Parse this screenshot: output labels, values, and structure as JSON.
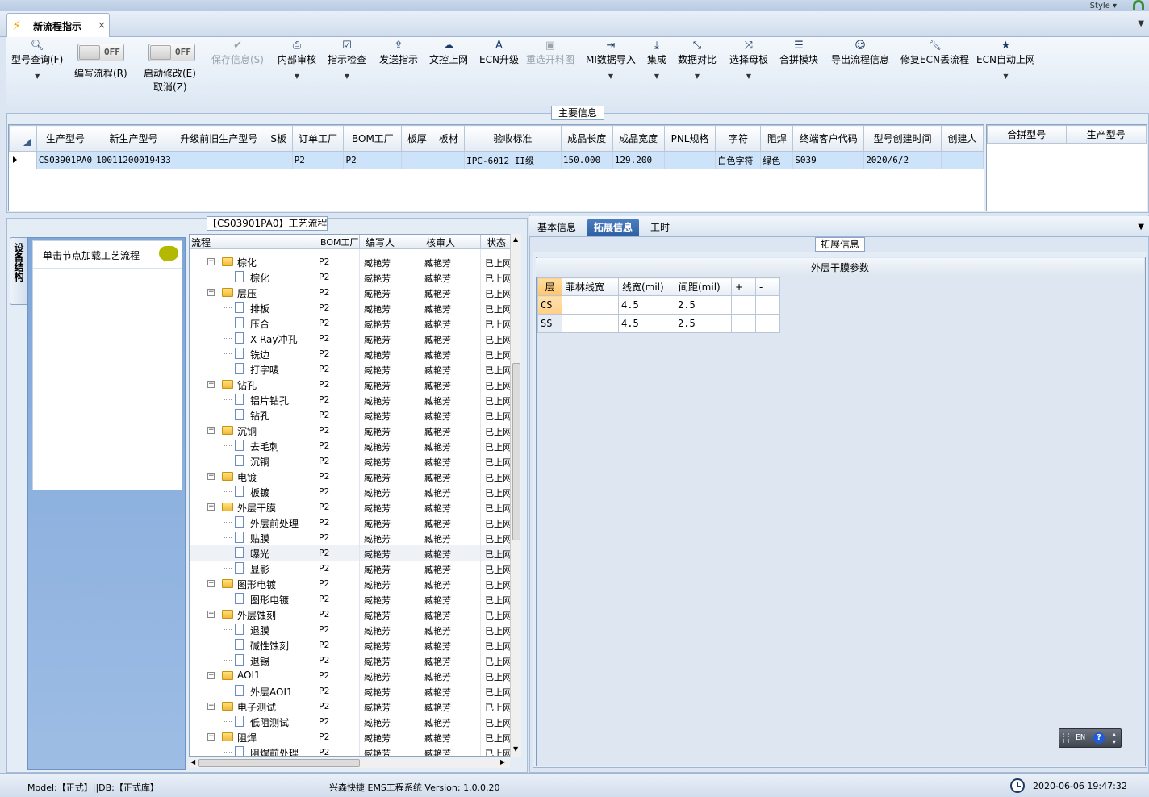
{
  "topbar": {
    "style_label": "Style ▾"
  },
  "doc_tab": {
    "title": "新流程指示",
    "close": "×"
  },
  "ribbon": {
    "query": "型号查询(F)",
    "toggle_off": "OFF",
    "write_flow": "编写流程(R)",
    "start_modify": "启动修改(E)",
    "cancel": "取消(Z)",
    "save_info": "保存信息(S)",
    "internal_review": "内部审核",
    "instruction_check": "指示检查",
    "send_instruction": "发送指示",
    "file_control_upload": "文控上网",
    "ecn_upgrade": "ECN升级",
    "reselect_drawing": "重选开料图",
    "mi_import": "MI数据导入",
    "integrate": "集成",
    "data_compare": "数据对比",
    "select_mother": "选择母板",
    "combine_module": "合拼模块",
    "export_flow": "导出流程信息",
    "fix_ecn": "修复ECN丢流程",
    "ecn_auto_upload": "ECN自动上网"
  },
  "main_info": {
    "title": "主要信息",
    "columns": [
      "生产型号",
      "新生产型号",
      "升级前旧生产型号",
      "S板",
      "订单工厂",
      "BOM工厂",
      "板厚",
      "板材",
      "验收标准",
      "成品长度",
      "成品宽度",
      "PNL规格",
      "字符",
      "阻焊",
      "终端客户代码",
      "型号创建时间",
      "创建人"
    ],
    "row": [
      "CS03901PA0",
      "10011200019433",
      "",
      "",
      "P2",
      "P2",
      "",
      "",
      "IPC-6012 II级",
      "150.000",
      "129.200",
      "",
      "白色字符",
      "绿色",
      "S039",
      "2020/6/2",
      ""
    ],
    "right_columns": [
      "合拼型号",
      "生产型号"
    ]
  },
  "process": {
    "title": "【CS03901PA0】工艺流程",
    "side_tab": "设备结构",
    "load_hint": "单击节点加载工艺流程",
    "headers": [
      "流程",
      "BOM工厂",
      "编写人",
      "核审人",
      "状态"
    ],
    "rows": [
      {
        "name": "棕化",
        "level": 0,
        "factory": "P2",
        "writer": "臧艳芳",
        "reviewer": "臧艳芳",
        "status": "已上网"
      },
      {
        "name": "棕化",
        "level": 1,
        "factory": "P2",
        "writer": "臧艳芳",
        "reviewer": "臧艳芳",
        "status": "已上网"
      },
      {
        "name": "层压",
        "level": 0,
        "factory": "P2",
        "writer": "臧艳芳",
        "reviewer": "臧艳芳",
        "status": "已上网"
      },
      {
        "name": "排板",
        "level": 1,
        "factory": "P2",
        "writer": "臧艳芳",
        "reviewer": "臧艳芳",
        "status": "已上网"
      },
      {
        "name": "压合",
        "level": 1,
        "factory": "P2",
        "writer": "臧艳芳",
        "reviewer": "臧艳芳",
        "status": "已上网"
      },
      {
        "name": "X-Ray冲孔",
        "level": 1,
        "factory": "P2",
        "writer": "臧艳芳",
        "reviewer": "臧艳芳",
        "status": "已上网"
      },
      {
        "name": "铣边",
        "level": 1,
        "factory": "P2",
        "writer": "臧艳芳",
        "reviewer": "臧艳芳",
        "status": "已上网"
      },
      {
        "name": "打字唛",
        "level": 1,
        "factory": "P2",
        "writer": "臧艳芳",
        "reviewer": "臧艳芳",
        "status": "已上网"
      },
      {
        "name": "钻孔",
        "level": 0,
        "factory": "P2",
        "writer": "臧艳芳",
        "reviewer": "臧艳芳",
        "status": "已上网"
      },
      {
        "name": "铝片钻孔",
        "level": 1,
        "factory": "P2",
        "writer": "臧艳芳",
        "reviewer": "臧艳芳",
        "status": "已上网"
      },
      {
        "name": "钻孔",
        "level": 1,
        "factory": "P2",
        "writer": "臧艳芳",
        "reviewer": "臧艳芳",
        "status": "已上网"
      },
      {
        "name": "沉铜",
        "level": 0,
        "factory": "P2",
        "writer": "臧艳芳",
        "reviewer": "臧艳芳",
        "status": "已上网"
      },
      {
        "name": "去毛刺",
        "level": 1,
        "factory": "P2",
        "writer": "臧艳芳",
        "reviewer": "臧艳芳",
        "status": "已上网"
      },
      {
        "name": "沉铜",
        "level": 1,
        "factory": "P2",
        "writer": "臧艳芳",
        "reviewer": "臧艳芳",
        "status": "已上网"
      },
      {
        "name": "电镀",
        "level": 0,
        "factory": "P2",
        "writer": "臧艳芳",
        "reviewer": "臧艳芳",
        "status": "已上网"
      },
      {
        "name": "板镀",
        "level": 1,
        "factory": "P2",
        "writer": "臧艳芳",
        "reviewer": "臧艳芳",
        "status": "已上网"
      },
      {
        "name": "外层干膜",
        "level": 0,
        "factory": "P2",
        "writer": "臧艳芳",
        "reviewer": "臧艳芳",
        "status": "已上网"
      },
      {
        "name": "外层前处理",
        "level": 1,
        "factory": "P2",
        "writer": "臧艳芳",
        "reviewer": "臧艳芳",
        "status": "已上网"
      },
      {
        "name": "贴膜",
        "level": 1,
        "factory": "P2",
        "writer": "臧艳芳",
        "reviewer": "臧艳芳",
        "status": "已上网"
      },
      {
        "name": "曝光",
        "level": 1,
        "factory": "P2",
        "writer": "臧艳芳",
        "reviewer": "臧艳芳",
        "status": "已上网",
        "selected": true
      },
      {
        "name": "显影",
        "level": 1,
        "factory": "P2",
        "writer": "臧艳芳",
        "reviewer": "臧艳芳",
        "status": "已上网"
      },
      {
        "name": "图形电镀",
        "level": 0,
        "factory": "P2",
        "writer": "臧艳芳",
        "reviewer": "臧艳芳",
        "status": "已上网"
      },
      {
        "name": "图形电镀",
        "level": 1,
        "factory": "P2",
        "writer": "臧艳芳",
        "reviewer": "臧艳芳",
        "status": "已上网"
      },
      {
        "name": "外层蚀刻",
        "level": 0,
        "factory": "P2",
        "writer": "臧艳芳",
        "reviewer": "臧艳芳",
        "status": "已上网"
      },
      {
        "name": "退膜",
        "level": 1,
        "factory": "P2",
        "writer": "臧艳芳",
        "reviewer": "臧艳芳",
        "status": "已上网"
      },
      {
        "name": "碱性蚀刻",
        "level": 1,
        "factory": "P2",
        "writer": "臧艳芳",
        "reviewer": "臧艳芳",
        "status": "已上网"
      },
      {
        "name": "退锡",
        "level": 1,
        "factory": "P2",
        "writer": "臧艳芳",
        "reviewer": "臧艳芳",
        "status": "已上网"
      },
      {
        "name": "AOI1",
        "level": 0,
        "factory": "P2",
        "writer": "臧艳芳",
        "reviewer": "臧艳芳",
        "status": "已上网"
      },
      {
        "name": "外层AOI1",
        "level": 1,
        "factory": "P2",
        "writer": "臧艳芳",
        "reviewer": "臧艳芳",
        "status": "已上网"
      },
      {
        "name": "电子测试",
        "level": 0,
        "factory": "P2",
        "writer": "臧艳芳",
        "reviewer": "臧艳芳",
        "status": "已上网"
      },
      {
        "name": "低阻测试",
        "level": 1,
        "factory": "P2",
        "writer": "臧艳芳",
        "reviewer": "臧艳芳",
        "status": "已上网"
      },
      {
        "name": "阻焊",
        "level": 0,
        "factory": "P2",
        "writer": "臧艳芳",
        "reviewer": "臧艳芳",
        "status": "已上网"
      },
      {
        "name": "阻焊前处理",
        "level": 1,
        "factory": "P2",
        "writer": "臧艳芳",
        "reviewer": "臧艳芳",
        "status": "已上网"
      }
    ]
  },
  "right": {
    "tabs": [
      "基本信息",
      "拓展信息",
      "工时"
    ],
    "active_tab": "拓展信息",
    "ext_title": "拓展信息",
    "film_title": "外层干膜参数",
    "film_columns": [
      "层",
      "菲林线宽",
      "线宽(mil)",
      "间距(mil)",
      "+",
      "-"
    ],
    "film_rows": [
      {
        "layer": "CS",
        "film": "",
        "width": "4.5",
        "spacing": "2.5",
        "selected": true
      },
      {
        "layer": "SS",
        "film": "",
        "width": "4.5",
        "spacing": "2.5"
      }
    ],
    "ime": {
      "lang": "EN",
      "help": "?"
    }
  },
  "status": {
    "model": "Model:【正式】||DB:【正式库】",
    "system": "兴森快捷 EMS工程系统 Version: 1.0.0.20",
    "datetime": "2020-06-06 19:47:32"
  }
}
